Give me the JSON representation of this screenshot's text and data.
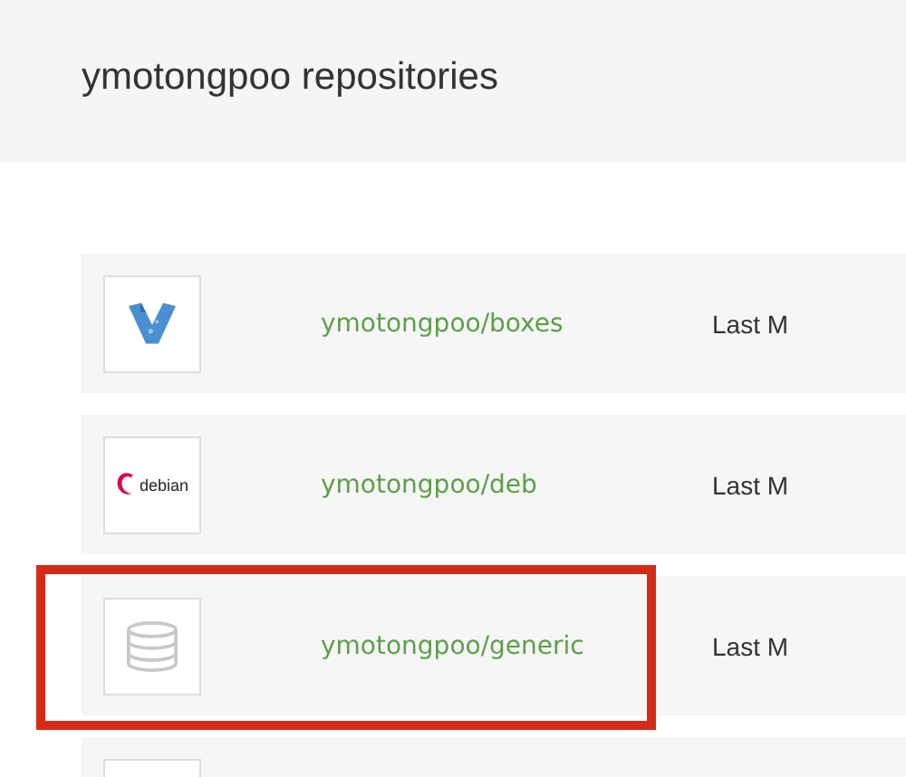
{
  "header": {
    "title": "ymotongpoo repositories"
  },
  "rows": [
    {
      "kind": "vagrant",
      "name": "ymotongpoo/boxes",
      "status": "Last M",
      "highlighted": false
    },
    {
      "kind": "debian",
      "logo_text": "debian",
      "name": "ymotongpoo/deb",
      "status": "Last M",
      "highlighted": false
    },
    {
      "kind": "database",
      "name": "ymotongpoo/generic",
      "status": "Last M",
      "highlighted": true
    },
    {
      "kind": "blank",
      "highlighted": false
    }
  ]
}
